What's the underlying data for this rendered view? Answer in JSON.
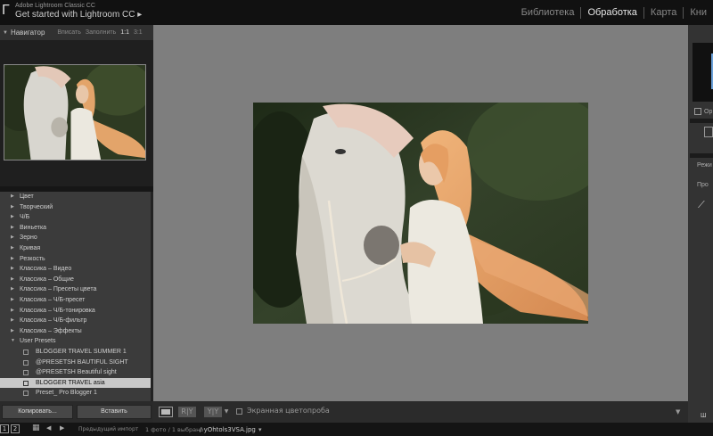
{
  "app": {
    "name_small": "Adobe Lightroom Classic CC",
    "title": "Get started with Lightroom CC",
    "title_arrow": "▸"
  },
  "modules": [
    {
      "label": "Библиотека",
      "active": false
    },
    {
      "label": "Обработка",
      "active": true
    },
    {
      "label": "Карта",
      "active": false
    },
    {
      "label": "Кни",
      "active": false
    }
  ],
  "navigator": {
    "title": "Навигатор",
    "options": [
      "Вписать",
      "Заполнить",
      "1:1",
      "3:1"
    ]
  },
  "presets": [
    {
      "label": "Цвет",
      "type": "folder"
    },
    {
      "label": "Творческий",
      "type": "folder"
    },
    {
      "label": "Ч/Б",
      "type": "folder"
    },
    {
      "label": "Виньетка",
      "type": "folder"
    },
    {
      "label": "Зерно",
      "type": "folder"
    },
    {
      "label": "Кривая",
      "type": "folder"
    },
    {
      "label": "Резкость",
      "type": "folder"
    },
    {
      "label": "Классика – Видео",
      "type": "folder"
    },
    {
      "label": "Классика – Общие",
      "type": "folder"
    },
    {
      "label": "Классика – Пресеты цвета",
      "type": "folder"
    },
    {
      "label": "Классика – Ч/Б-пресет",
      "type": "folder"
    },
    {
      "label": "Классика – Ч/Б-тонировка",
      "type": "folder"
    },
    {
      "label": "Классика – Ч/Б-фильтр",
      "type": "folder"
    },
    {
      "label": "Классика – Эффекты",
      "type": "folder"
    },
    {
      "label": "User Presets",
      "type": "folder-open"
    },
    {
      "label": "BLOGGER TRAVEL SUMMER 1",
      "type": "preset"
    },
    {
      "label": "@PRESETSH BAUTIFUL SIGHT",
      "type": "preset"
    },
    {
      "label": "@PRESETSH Beautiful sight",
      "type": "preset"
    },
    {
      "label": "BLOGGER TRAVEL asia",
      "type": "preset",
      "selected": true
    },
    {
      "label": "Preset_ Pro Blogger 1",
      "type": "preset"
    }
  ],
  "buttons": {
    "copy": "Копировать...",
    "paste": "Вставить"
  },
  "toolbar": {
    "ry1": "R|Y",
    "ry2": "Y|Y",
    "softproof_label": "Экранная цветопроба",
    "dropdown": "▼"
  },
  "right_panel": {
    "orig": "Ор",
    "mode": "Режи",
    "profile": "Про"
  },
  "filmstrip": {
    "page1": "1",
    "page2": "2",
    "grid_icon": "▦",
    "back": "◀",
    "forward": "▶",
    "source": "Предыдущий импорт",
    "count": "1 фото / 1 выбрано",
    "filename": "/ yOhtols3VSA.jpg",
    "caret": "▾"
  },
  "colors": {
    "active_module": "#e8e8e8",
    "center_bg": "#7e7e7e",
    "selected_row": "#c8c8c8"
  }
}
